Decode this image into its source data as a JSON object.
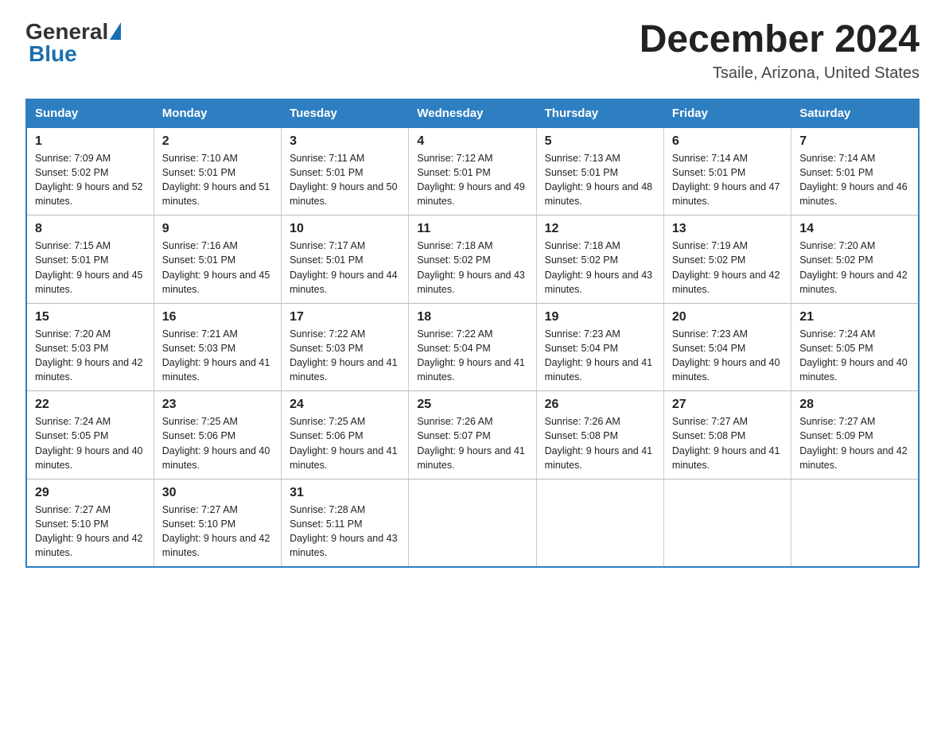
{
  "header": {
    "title": "December 2024",
    "subtitle": "Tsaile, Arizona, United States",
    "logo_general": "General",
    "logo_blue": "Blue"
  },
  "weekdays": [
    "Sunday",
    "Monday",
    "Tuesday",
    "Wednesday",
    "Thursday",
    "Friday",
    "Saturday"
  ],
  "weeks": [
    [
      {
        "day": "1",
        "sunrise": "7:09 AM",
        "sunset": "5:02 PM",
        "daylight": "9 hours and 52 minutes."
      },
      {
        "day": "2",
        "sunrise": "7:10 AM",
        "sunset": "5:01 PM",
        "daylight": "9 hours and 51 minutes."
      },
      {
        "day": "3",
        "sunrise": "7:11 AM",
        "sunset": "5:01 PM",
        "daylight": "9 hours and 50 minutes."
      },
      {
        "day": "4",
        "sunrise": "7:12 AM",
        "sunset": "5:01 PM",
        "daylight": "9 hours and 49 minutes."
      },
      {
        "day": "5",
        "sunrise": "7:13 AM",
        "sunset": "5:01 PM",
        "daylight": "9 hours and 48 minutes."
      },
      {
        "day": "6",
        "sunrise": "7:14 AM",
        "sunset": "5:01 PM",
        "daylight": "9 hours and 47 minutes."
      },
      {
        "day": "7",
        "sunrise": "7:14 AM",
        "sunset": "5:01 PM",
        "daylight": "9 hours and 46 minutes."
      }
    ],
    [
      {
        "day": "8",
        "sunrise": "7:15 AM",
        "sunset": "5:01 PM",
        "daylight": "9 hours and 45 minutes."
      },
      {
        "day": "9",
        "sunrise": "7:16 AM",
        "sunset": "5:01 PM",
        "daylight": "9 hours and 45 minutes."
      },
      {
        "day": "10",
        "sunrise": "7:17 AM",
        "sunset": "5:01 PM",
        "daylight": "9 hours and 44 minutes."
      },
      {
        "day": "11",
        "sunrise": "7:18 AM",
        "sunset": "5:02 PM",
        "daylight": "9 hours and 43 minutes."
      },
      {
        "day": "12",
        "sunrise": "7:18 AM",
        "sunset": "5:02 PM",
        "daylight": "9 hours and 43 minutes."
      },
      {
        "day": "13",
        "sunrise": "7:19 AM",
        "sunset": "5:02 PM",
        "daylight": "9 hours and 42 minutes."
      },
      {
        "day": "14",
        "sunrise": "7:20 AM",
        "sunset": "5:02 PM",
        "daylight": "9 hours and 42 minutes."
      }
    ],
    [
      {
        "day": "15",
        "sunrise": "7:20 AM",
        "sunset": "5:03 PM",
        "daylight": "9 hours and 42 minutes."
      },
      {
        "day": "16",
        "sunrise": "7:21 AM",
        "sunset": "5:03 PM",
        "daylight": "9 hours and 41 minutes."
      },
      {
        "day": "17",
        "sunrise": "7:22 AM",
        "sunset": "5:03 PM",
        "daylight": "9 hours and 41 minutes."
      },
      {
        "day": "18",
        "sunrise": "7:22 AM",
        "sunset": "5:04 PM",
        "daylight": "9 hours and 41 minutes."
      },
      {
        "day": "19",
        "sunrise": "7:23 AM",
        "sunset": "5:04 PM",
        "daylight": "9 hours and 41 minutes."
      },
      {
        "day": "20",
        "sunrise": "7:23 AM",
        "sunset": "5:04 PM",
        "daylight": "9 hours and 40 minutes."
      },
      {
        "day": "21",
        "sunrise": "7:24 AM",
        "sunset": "5:05 PM",
        "daylight": "9 hours and 40 minutes."
      }
    ],
    [
      {
        "day": "22",
        "sunrise": "7:24 AM",
        "sunset": "5:05 PM",
        "daylight": "9 hours and 40 minutes."
      },
      {
        "day": "23",
        "sunrise": "7:25 AM",
        "sunset": "5:06 PM",
        "daylight": "9 hours and 40 minutes."
      },
      {
        "day": "24",
        "sunrise": "7:25 AM",
        "sunset": "5:06 PM",
        "daylight": "9 hours and 41 minutes."
      },
      {
        "day": "25",
        "sunrise": "7:26 AM",
        "sunset": "5:07 PM",
        "daylight": "9 hours and 41 minutes."
      },
      {
        "day": "26",
        "sunrise": "7:26 AM",
        "sunset": "5:08 PM",
        "daylight": "9 hours and 41 minutes."
      },
      {
        "day": "27",
        "sunrise": "7:27 AM",
        "sunset": "5:08 PM",
        "daylight": "9 hours and 41 minutes."
      },
      {
        "day": "28",
        "sunrise": "7:27 AM",
        "sunset": "5:09 PM",
        "daylight": "9 hours and 42 minutes."
      }
    ],
    [
      {
        "day": "29",
        "sunrise": "7:27 AM",
        "sunset": "5:10 PM",
        "daylight": "9 hours and 42 minutes."
      },
      {
        "day": "30",
        "sunrise": "7:27 AM",
        "sunset": "5:10 PM",
        "daylight": "9 hours and 42 minutes."
      },
      {
        "day": "31",
        "sunrise": "7:28 AM",
        "sunset": "5:11 PM",
        "daylight": "9 hours and 43 minutes."
      },
      null,
      null,
      null,
      null
    ]
  ]
}
